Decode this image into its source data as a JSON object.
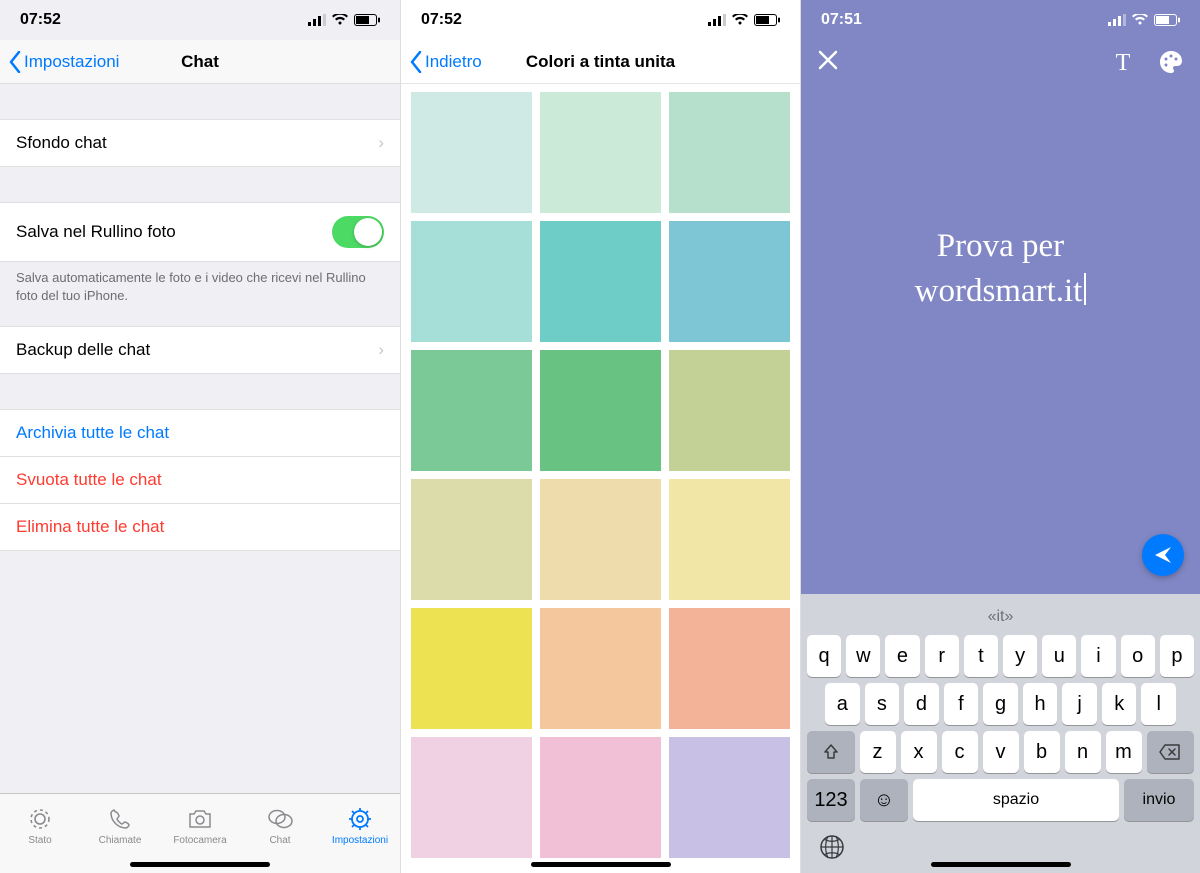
{
  "screen1": {
    "time": "07:52",
    "back_label": "Impostazioni",
    "title": "Chat",
    "rows": {
      "wallpaper": "Sfondo chat",
      "save_camera": "Salva nel Rullino foto",
      "save_camera_note": "Salva automaticamente le foto e i video che ricevi nel Rullino foto del tuo iPhone.",
      "backup": "Backup delle chat",
      "archive_all": "Archivia tutte le chat",
      "clear_all": "Svuota tutte le chat",
      "delete_all": "Elimina tutte le chat"
    },
    "tabs": {
      "status": "Stato",
      "calls": "Chiamate",
      "camera": "Fotocamera",
      "chats": "Chat",
      "settings": "Impostazioni"
    }
  },
  "screen2": {
    "time": "07:52",
    "back_label": "Indietro",
    "title": "Colori a tinta unita",
    "colors": [
      "#cfe9e4",
      "#cbead7",
      "#b7e0cc",
      "#a6dfd8",
      "#6ecec7",
      "#7ec6d6",
      "#7bc997",
      "#68c281",
      "#c3d196",
      "#dcdbaa",
      "#eedcad",
      "#f2e6a7",
      "#ede252",
      "#f4c79d",
      "#f2b398",
      "#f0d1e3",
      "#f1bfd6",
      "#c9c0e6"
    ]
  },
  "screen3": {
    "time": "07:51",
    "text": "Prova per\nwordsmart.it",
    "background": "#8187c4",
    "keyboard": {
      "suggestion": "«it»",
      "rows": [
        [
          "q",
          "w",
          "e",
          "r",
          "t",
          "y",
          "u",
          "i",
          "o",
          "p"
        ],
        [
          "a",
          "s",
          "d",
          "f",
          "g",
          "h",
          "j",
          "k",
          "l"
        ],
        [
          "z",
          "x",
          "c",
          "v",
          "b",
          "n",
          "m"
        ]
      ],
      "numbers_key": "123",
      "space_key": "spazio",
      "return_key": "invio"
    }
  }
}
